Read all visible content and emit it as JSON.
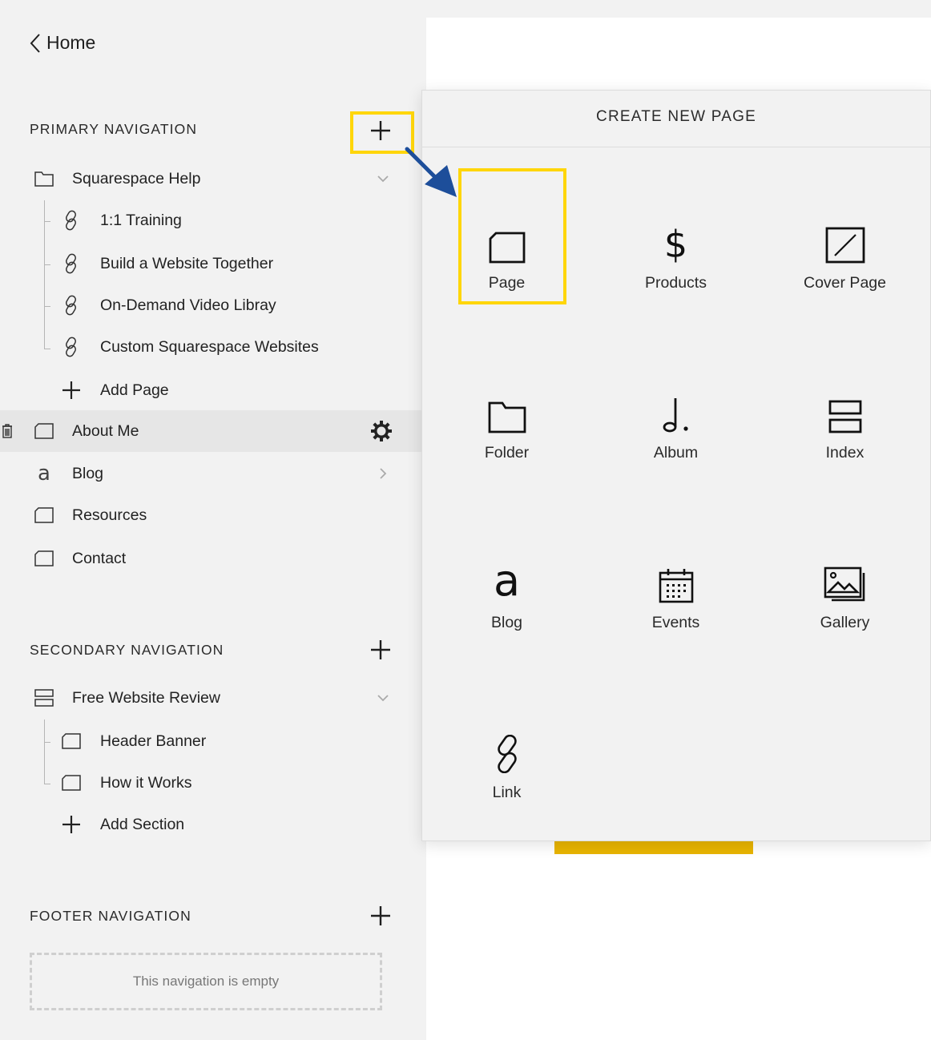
{
  "back": {
    "label": "Home"
  },
  "primary": {
    "title": "PRIMARY NAVIGATION",
    "folder": {
      "label": "Squarespace Help"
    },
    "children": [
      {
        "label": "1:1 Training"
      },
      {
        "label": "Build a Website Together"
      },
      {
        "label": "On-Demand Video Libray"
      },
      {
        "label": "Custom Squarespace Websites"
      }
    ],
    "add_page_label": "Add Page",
    "pages": [
      {
        "label": "About Me"
      },
      {
        "label": "Blog"
      },
      {
        "label": "Resources"
      },
      {
        "label": "Contact"
      }
    ]
  },
  "secondary": {
    "title": "SECONDARY NAVIGATION",
    "index": {
      "label": "Free Website Review"
    },
    "children": [
      {
        "label": "Header Banner"
      },
      {
        "label": "How it Works"
      }
    ],
    "add_section_label": "Add Section"
  },
  "footer": {
    "title": "FOOTER NAVIGATION",
    "empty_text": "This navigation is empty"
  },
  "create_panel": {
    "title": "CREATE NEW PAGE",
    "options": [
      {
        "label": "Page",
        "icon": "page-icon"
      },
      {
        "label": "Products",
        "icon": "dollar-icon"
      },
      {
        "label": "Cover Page",
        "icon": "cover-page-icon"
      },
      {
        "label": "Folder",
        "icon": "folder-icon"
      },
      {
        "label": "Album",
        "icon": "music-note-icon"
      },
      {
        "label": "Index",
        "icon": "index-icon"
      },
      {
        "label": "Blog",
        "icon": "blog-icon"
      },
      {
        "label": "Events",
        "icon": "calendar-icon"
      },
      {
        "label": "Gallery",
        "icon": "gallery-icon"
      },
      {
        "label": "Link",
        "icon": "link-icon"
      }
    ]
  },
  "colors": {
    "highlight": "#ffd60a",
    "arrow": "#1d4e9a",
    "preview_accent": "#e8b400"
  }
}
